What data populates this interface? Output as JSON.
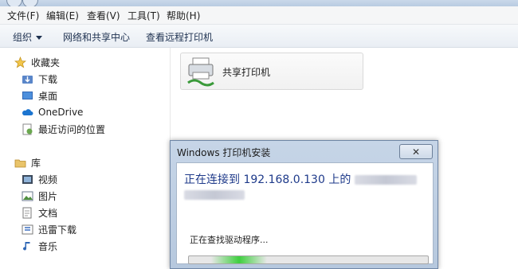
{
  "menubar": {
    "items": [
      "文件(F)",
      "编辑(E)",
      "查看(V)",
      "工具(T)",
      "帮助(H)"
    ]
  },
  "toolbar": {
    "organize": "组织",
    "network_center": "网络和共享中心",
    "view_remote_printers": "查看远程打印机"
  },
  "nav": {
    "favorites": "收藏夹",
    "downloads": "下载",
    "desktop": "桌面",
    "onedrive": "OneDrive",
    "recent_places": "最近访问的位置",
    "libraries": "库",
    "videos": "视频",
    "pictures": "图片",
    "documents": "文档",
    "xunlei_downloads": "迅雷下载",
    "music": "音乐"
  },
  "content": {
    "shared_printer_label": "共享打印机"
  },
  "dialog": {
    "title": "Windows 打印机安装",
    "close_glyph": "✕",
    "heading": "正在连接到 192.168.0.130 上的",
    "status": "正在查找驱动程序...",
    "progress": 0.25
  },
  "colors": {
    "accent": "#1e3a8a",
    "progress_green": "#3fcf3f"
  }
}
